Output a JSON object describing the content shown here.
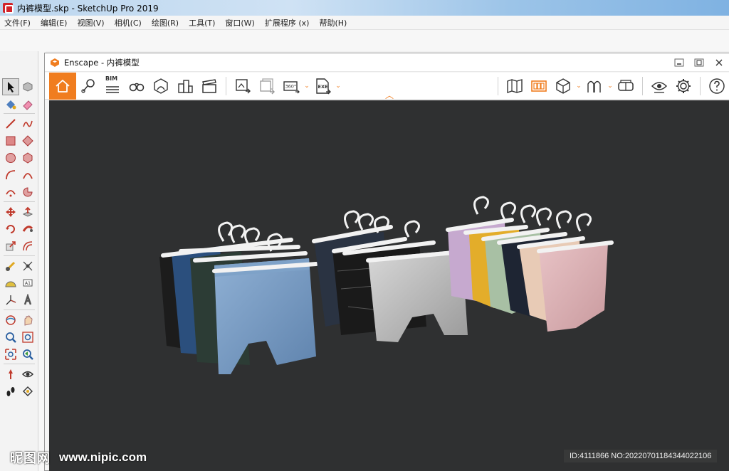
{
  "sketchup": {
    "window_title": "内裤模型.skp - SketchUp Pro 2019",
    "menu": [
      "文件(F)",
      "编辑(E)",
      "视图(V)",
      "相机(C)",
      "绘图(R)",
      "工具(T)",
      "窗口(W)",
      "扩展程序 (x)",
      "帮助(H)"
    ]
  },
  "palette_tools": [
    "select-tool",
    "component-tool",
    "paint-bucket-tool",
    "eraser-tool",
    "line-tool",
    "freehand-tool",
    "rectangle-tool",
    "rotated-rectangle-tool",
    "circle-tool",
    "polygon-tool",
    "arc-tool",
    "two-point-arc-tool",
    "three-point-arc-tool",
    "pie-tool",
    "move-tool",
    "push-pull-tool",
    "rotate-tool",
    "follow-me-tool",
    "scale-tool",
    "offset-tool",
    "tape-measure-tool",
    "dimension-tool",
    "protractor-tool",
    "text-tool",
    "axes-tool",
    "3d-text-tool",
    "orbit-tool",
    "pan-tool",
    "zoom-tool",
    "zoom-window-tool",
    "zoom-extents-tool",
    "previous-view-tool",
    "position-camera-tool",
    "look-around-tool",
    "walk-tool",
    "section-plane-tool"
  ],
  "enscape": {
    "window_title": "Enscape - 内裤模型",
    "toolbar": {
      "bim_label": "BIM",
      "pano_label": "360°",
      "exe_label": "EXE"
    }
  },
  "watermark": {
    "logo_text": "昵图网",
    "url": "www.nipic.com",
    "id_text": "ID:4111866 NO:20220701184344022106"
  },
  "colors": {
    "accent": "#f07d1f",
    "viewport_bg": "#2f3031"
  }
}
